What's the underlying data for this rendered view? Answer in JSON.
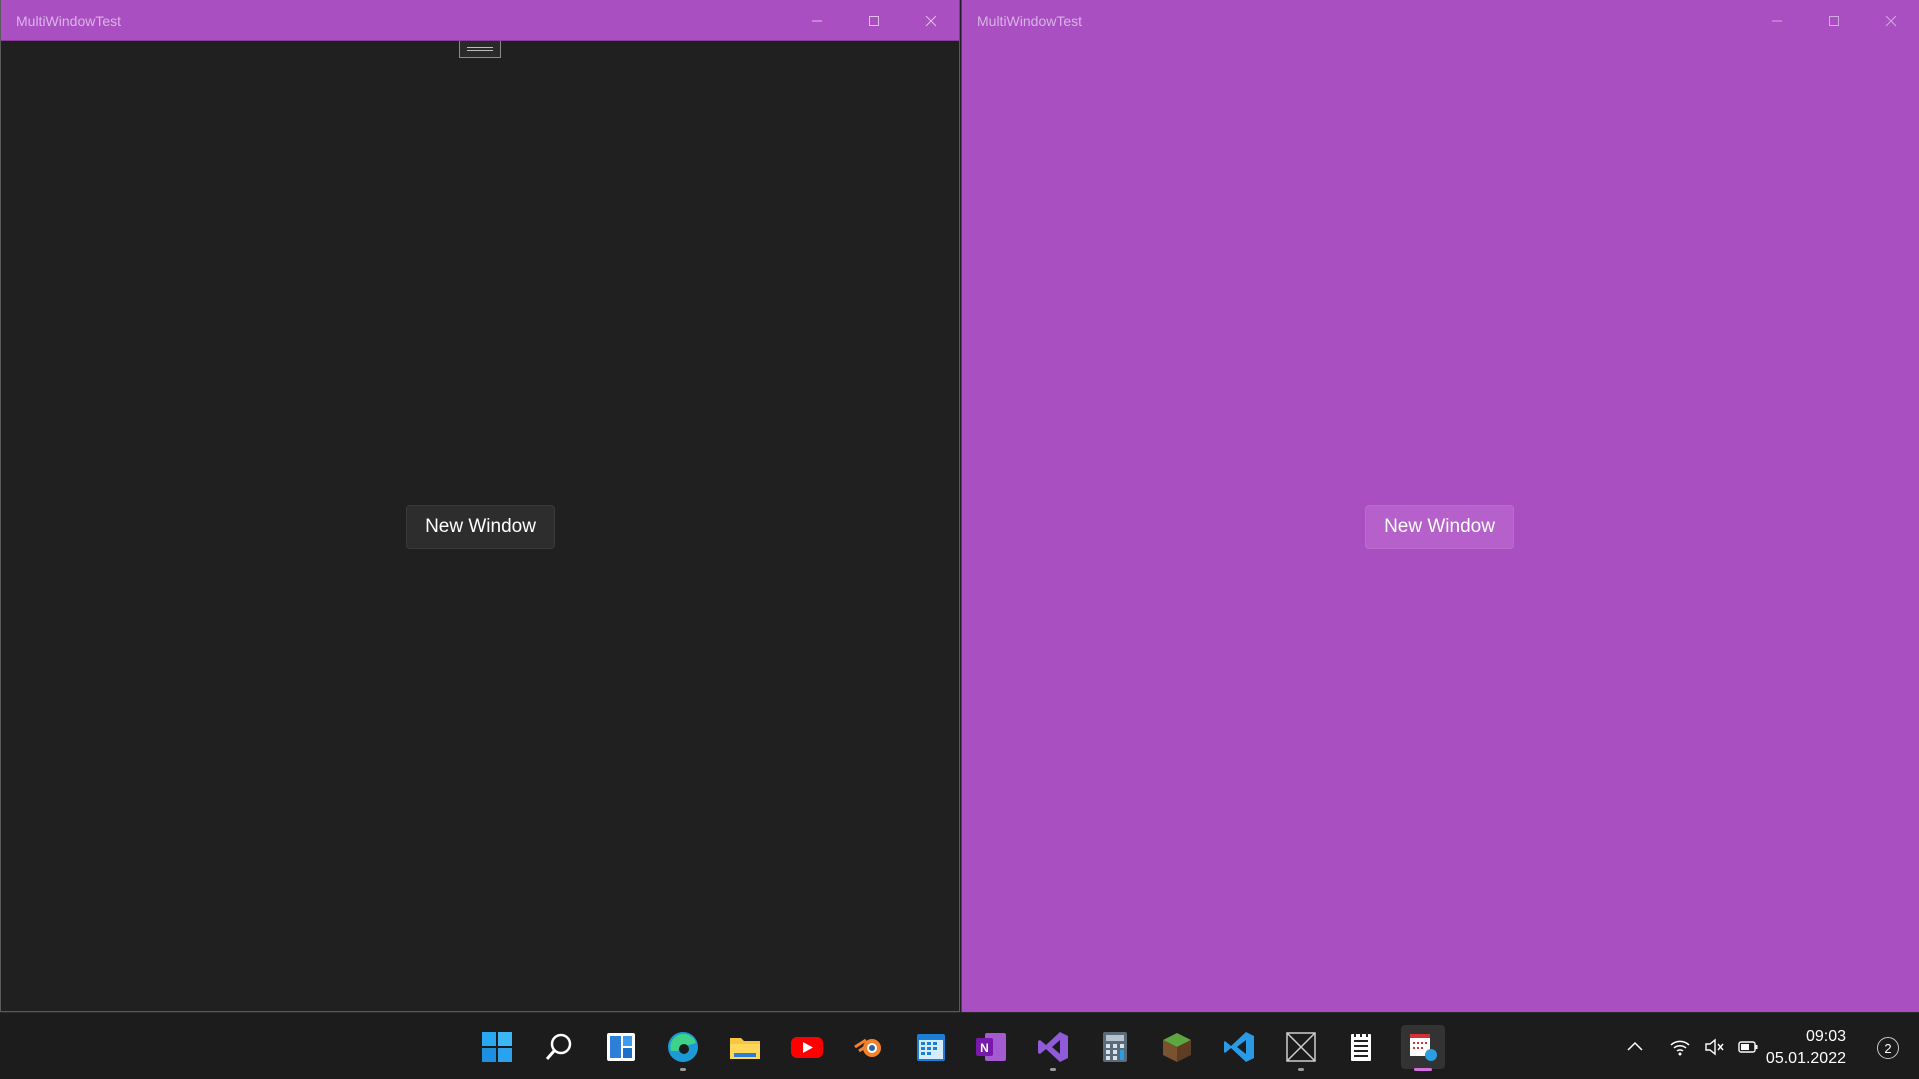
{
  "left_window": {
    "title": "MultiWindowTest",
    "button_label": "New Window"
  },
  "right_window": {
    "title": "MultiWindowTest",
    "button_label": "New Window"
  },
  "taskbar": {
    "pinned": [
      {
        "name": "start-icon"
      },
      {
        "name": "search-icon"
      },
      {
        "name": "widgets-icon"
      },
      {
        "name": "edge-icon"
      },
      {
        "name": "file-explorer-icon"
      },
      {
        "name": "youtube-icon"
      },
      {
        "name": "blender-icon"
      },
      {
        "name": "calendar-icon"
      },
      {
        "name": "onenote-icon"
      },
      {
        "name": "visual-studio-icon"
      },
      {
        "name": "calculator-icon"
      },
      {
        "name": "minecraft-icon"
      },
      {
        "name": "vscode-icon"
      },
      {
        "name": "blank-app-icon"
      },
      {
        "name": "notepad-icon"
      },
      {
        "name": "multiwindowtest-app-icon"
      }
    ],
    "clock_time": "09:03",
    "clock_date": "05.01.2022",
    "notification_count": "2"
  },
  "colors": {
    "accent": "#a94fc1",
    "dark_bg": "#202020",
    "taskbar_bg": "#1c1c1c"
  }
}
